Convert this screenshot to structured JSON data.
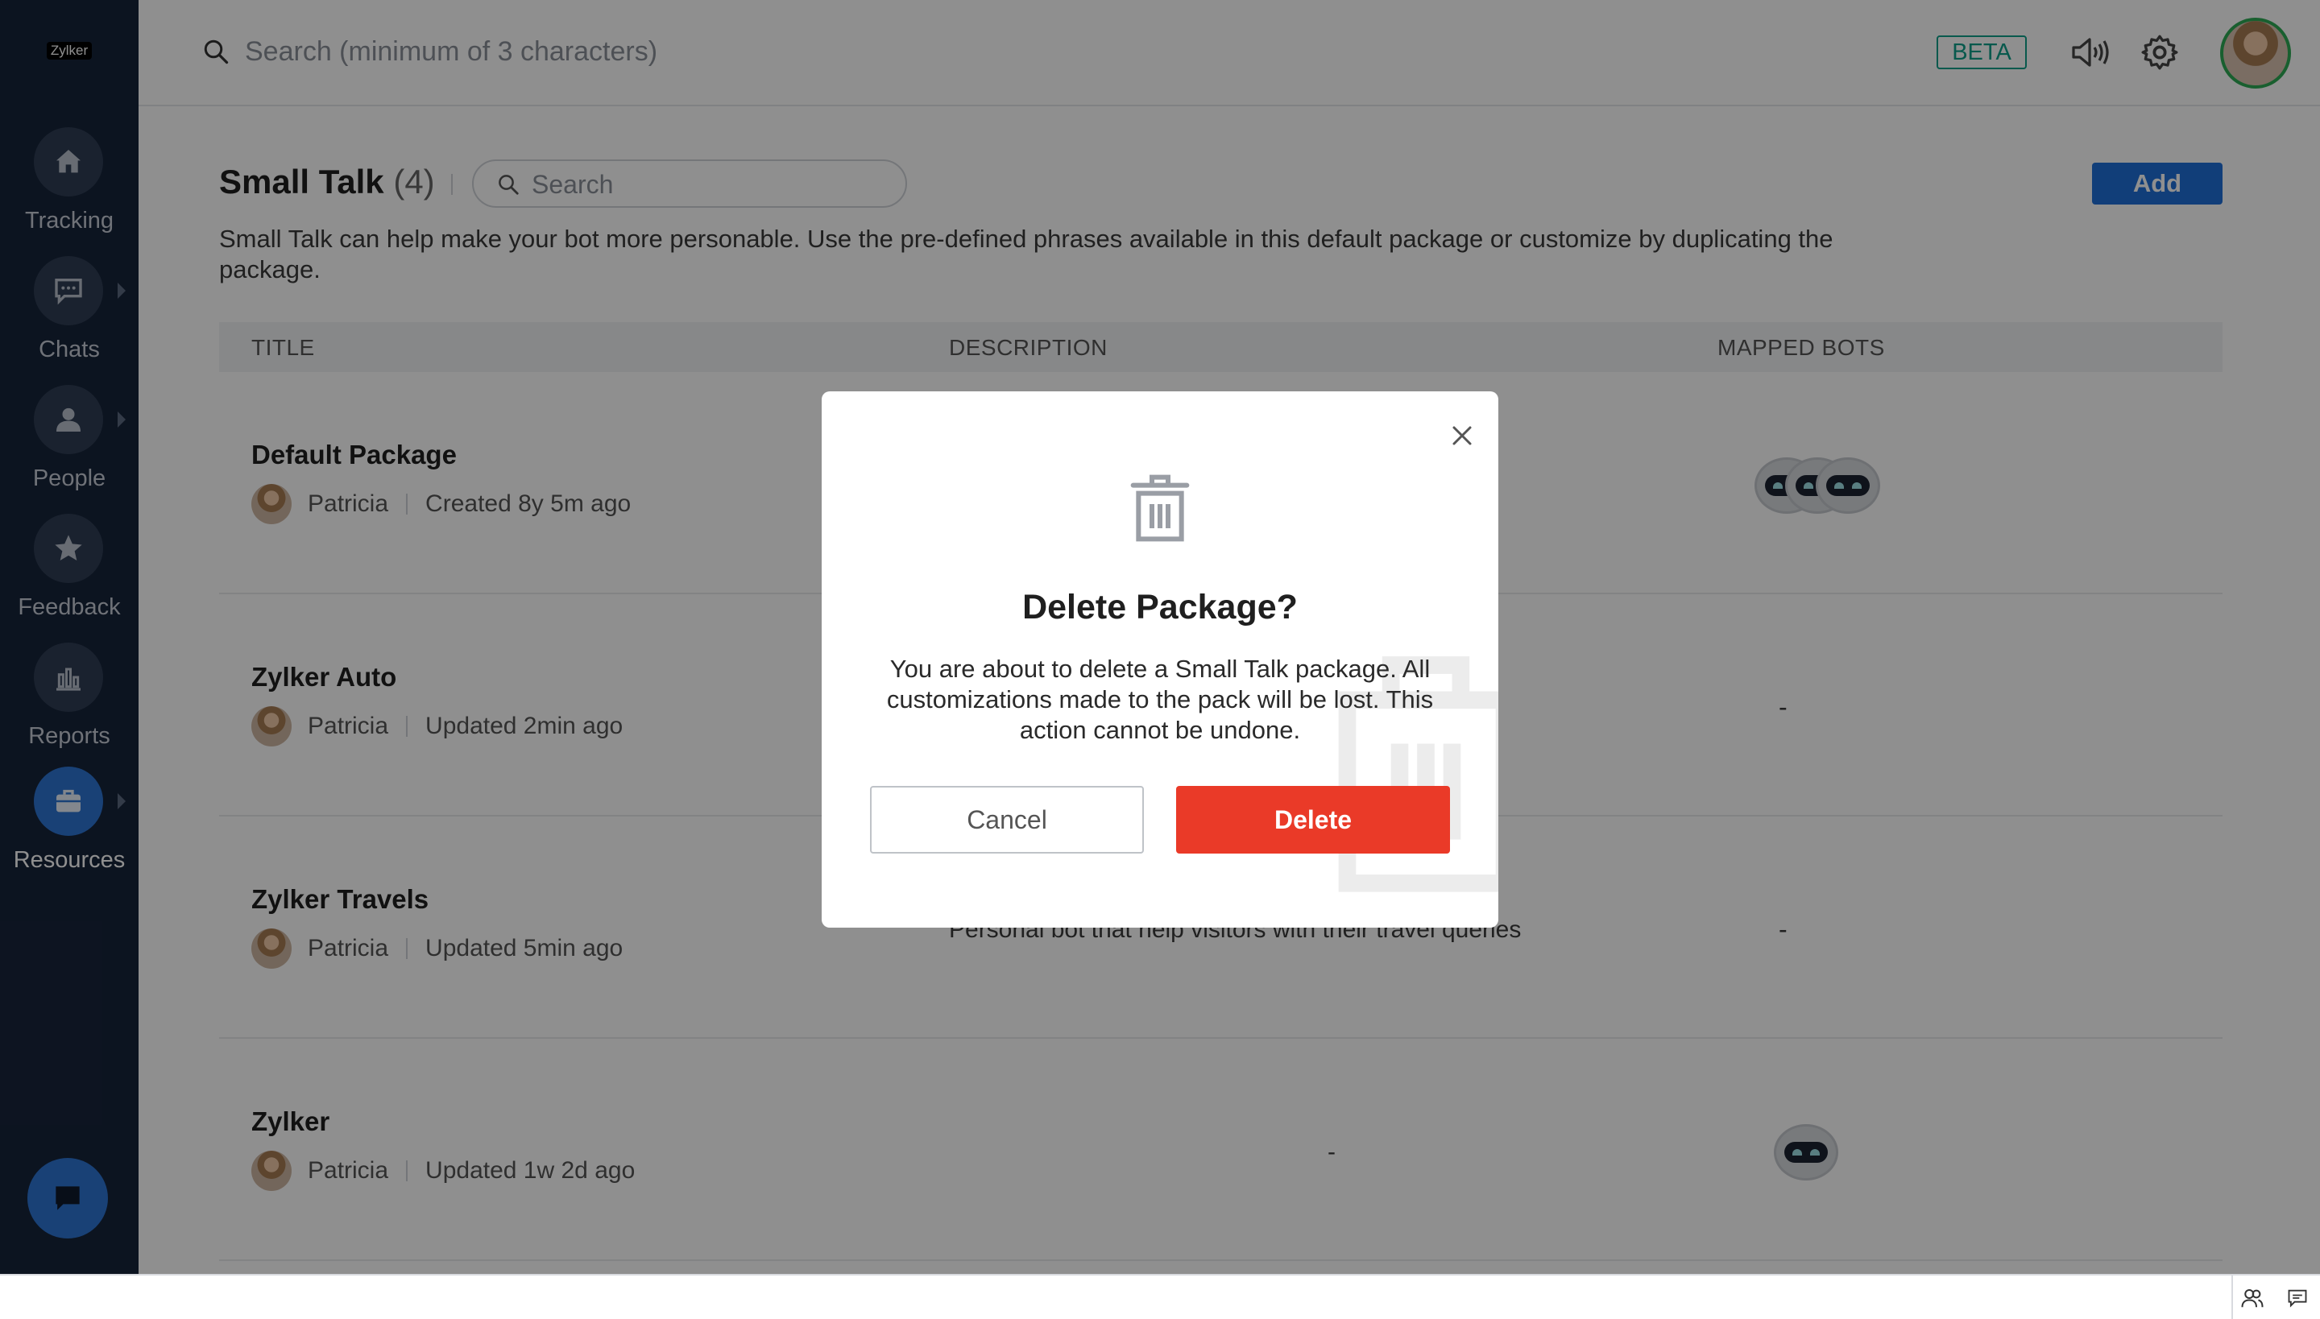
{
  "app": {
    "logo": "Zylker"
  },
  "sidebar": {
    "items": [
      {
        "label": "Tracking",
        "icon": "home-icon",
        "has_arrow": false
      },
      {
        "label": "Chats",
        "icon": "chat-icon",
        "has_arrow": true
      },
      {
        "label": "People",
        "icon": "person-icon",
        "has_arrow": true
      },
      {
        "label": "Feedback",
        "icon": "star-icon",
        "has_arrow": false
      },
      {
        "label": "Reports",
        "icon": "bar-chart-icon",
        "has_arrow": false
      },
      {
        "label": "Resources",
        "icon": "briefcase-icon",
        "has_arrow": true,
        "active": true
      }
    ]
  },
  "topbar": {
    "search_placeholder": "Search (minimum of 3 characters)",
    "beta_label": "BETA"
  },
  "page": {
    "title": "Small Talk",
    "count": "(4)",
    "search_placeholder": "Search",
    "add_label": "Add",
    "description": "Small Talk can help make your bot more personable. Use the pre-defined phrases available in this default package or customize by duplicating the package."
  },
  "table": {
    "columns": [
      "TITLE",
      "DESCRIPTION",
      "MAPPED BOTS"
    ],
    "rows": [
      {
        "title": "Default Package",
        "author": "Patricia",
        "status": "Created 8y 5m ago",
        "description": "",
        "bots_count": 3,
        "bots": ""
      },
      {
        "title": "Zylker Auto",
        "author": "Patricia",
        "status": "Updated 2min ago",
        "description": "",
        "bots_count": 0,
        "bots": "-"
      },
      {
        "title": "Zylker Travels",
        "author": "Patricia",
        "status": "Updated 5min ago",
        "description": "Personal bot that help visitors with their travel queries",
        "bots_count": 0,
        "bots": "-"
      },
      {
        "title": "Zylker",
        "author": "Patricia",
        "status": "Updated 1w 2d ago",
        "description": "-",
        "bots_count": 1,
        "bots": ""
      }
    ]
  },
  "modal": {
    "title": "Delete Package?",
    "body": "You are about to delete a Small Talk package. All customizations made to the pack will be lost. This action cannot be undone.",
    "cancel_label": "Cancel",
    "delete_label": "Delete",
    "delete_color": "#ea3a28"
  },
  "colors": {
    "sidebar_bg": "#17243a",
    "accent": "#1f6fd8",
    "beta": "#0f9f8a",
    "danger": "#ea3a28"
  }
}
